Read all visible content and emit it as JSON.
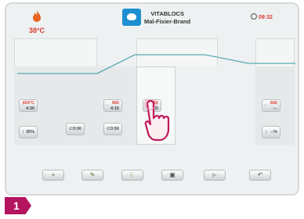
{
  "header": {
    "temperature": "38°C",
    "program_line1": "VITABLOCS",
    "program_line2": "Mal-Fixier-Brand",
    "time": "09:32"
  },
  "stages": {
    "s1_temp": "403°C",
    "s1_val": "4:30",
    "s1_rate": "35%",
    "s1b_val": "0:00",
    "s2_temp": "950",
    "s2_val": "4:15",
    "s2b_val": "0:50",
    "s3_temp": "880",
    "s3_val": "1:30",
    "s4_temp": "600",
    "s4_val": "---",
    "s4_rate": "--%"
  },
  "toolbar": {
    "b1": "+",
    "b2": "",
    "b3": "",
    "b4": "",
    "b5": "",
    "b6": ""
  },
  "step_number": "1",
  "colors": {
    "accent": "#1d8fd0",
    "temp_red": "#d93a2e",
    "badge": "#b5145e"
  }
}
